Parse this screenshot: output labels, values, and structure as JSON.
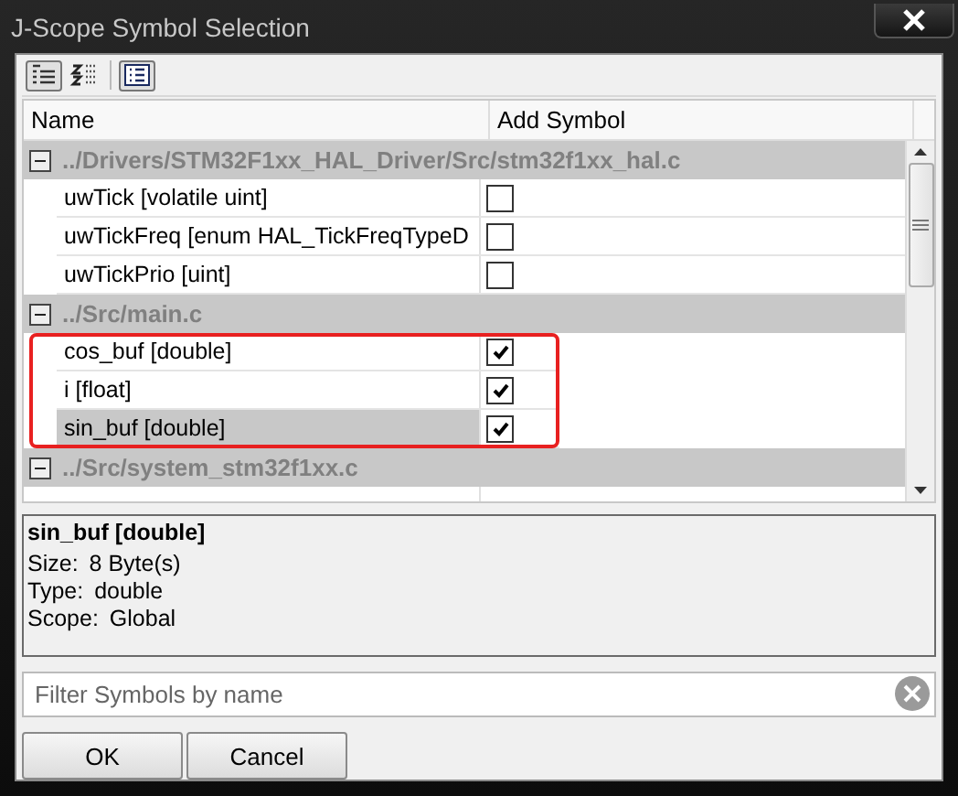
{
  "window": {
    "title": "J-Scope Symbol Selection"
  },
  "toolbar": [
    {
      "kind": "categorized",
      "pressed": true
    },
    {
      "kind": "sorted",
      "pressed": false
    },
    {
      "kind": "details",
      "pressed": true
    }
  ],
  "table": {
    "columns": [
      "Name",
      "Add Symbol"
    ],
    "groups": [
      {
        "path": "../Drivers/STM32F1xx_HAL_Driver/Src/stm32f1xx_hal.c",
        "expanded": true,
        "highlighted": false,
        "symbols": [
          {
            "name": "uwTick [volatile uint]",
            "checked": false,
            "selected": false
          },
          {
            "name": "uwTickFreq [enum HAL_TickFreqTypeD",
            "checked": false,
            "selected": false
          },
          {
            "name": "uwTickPrio [uint]",
            "checked": false,
            "selected": false
          }
        ]
      },
      {
        "path": "../Src/main.c",
        "expanded": true,
        "highlighted": true,
        "symbols": [
          {
            "name": "cos_buf [double]",
            "checked": true,
            "selected": false
          },
          {
            "name": "i [float]",
            "checked": true,
            "selected": false
          },
          {
            "name": "sin_buf [double]",
            "checked": true,
            "selected": true
          }
        ]
      },
      {
        "path": "../Src/system_stm32f1xx.c",
        "expanded": true,
        "highlighted": false
      }
    ]
  },
  "details": {
    "title": "sin_buf [double]",
    "lines": [
      {
        "label": "Size:",
        "value": "8 Byte(s)"
      },
      {
        "label": "Type:",
        "value": "double"
      },
      {
        "label": "Scope:",
        "value": "Global"
      }
    ]
  },
  "filter": {
    "placeholder": "Filter Symbols by name"
  },
  "buttons": [
    "OK",
    "Cancel"
  ]
}
